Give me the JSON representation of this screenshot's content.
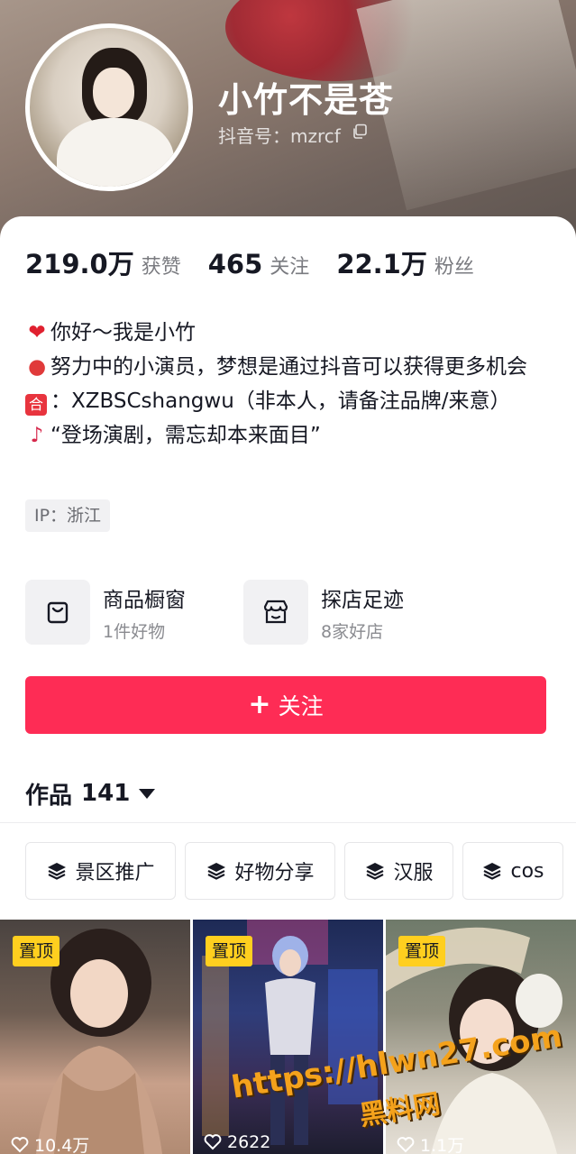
{
  "profile": {
    "name": "小竹不是苍",
    "douyin_id": "抖音号：mzrcf"
  },
  "stats": [
    {
      "value": "219.0万",
      "label": "获赞"
    },
    {
      "value": "465",
      "label": "关注"
    },
    {
      "value": "22.1万",
      "label": "粉丝"
    }
  ],
  "bio": {
    "line1": "你好～我是小竹",
    "line2": "努力中的小演员，梦想是通过抖音可以获得更多机会",
    "line3_badge": "合",
    "line3": "：XZBSCshangwu（非本人，请备注品牌/来意）",
    "line4": "“登场演剧，需忘却本来面目”"
  },
  "ip": "IP：浙江",
  "features": [
    {
      "title": "商品橱窗",
      "sub": "1件好物",
      "icon": "shopping-bag-icon"
    },
    {
      "title": "探店足迹",
      "sub": "8家好店",
      "icon": "store-icon"
    }
  ],
  "follow_button": {
    "label": "关注"
  },
  "works": {
    "label": "作品",
    "count": "141"
  },
  "chips": [
    {
      "label": "景区推广",
      "icon": "layers-icon"
    },
    {
      "label": "好物分享",
      "icon": "layers-icon"
    },
    {
      "label": "汉服",
      "icon": "layers-icon"
    },
    {
      "label": "cos",
      "icon": "layers-icon"
    }
  ],
  "videos": [
    {
      "badge": "置顶",
      "likes": "10.4万"
    },
    {
      "badge": "置顶",
      "likes": "2622"
    },
    {
      "badge": "置顶",
      "likes": "1.1万"
    }
  ],
  "watermark": {
    "line1": "https://hlwn27.com",
    "line2": "黑料网"
  },
  "colors": {
    "accent": "#fe2c55",
    "pin_badge": "#ffcf1f",
    "text": "#161823",
    "muted": "#7a7b80"
  }
}
